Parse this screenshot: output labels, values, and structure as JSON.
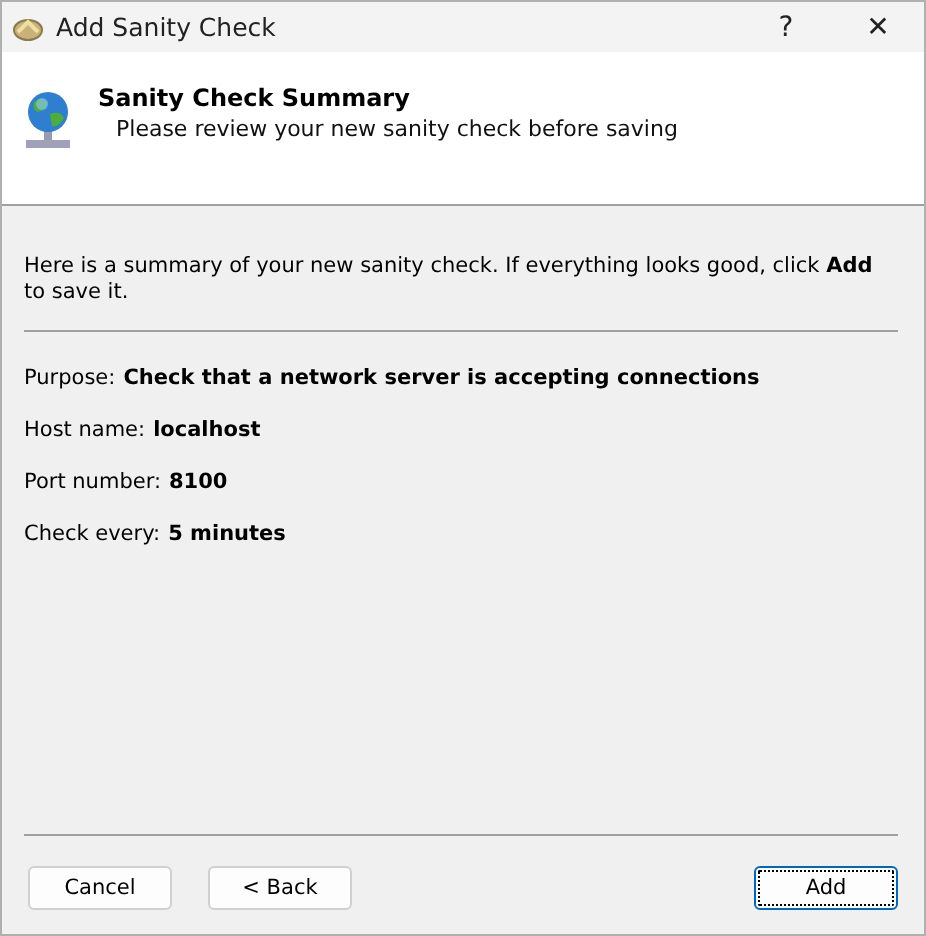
{
  "window": {
    "title": "Add Sanity Check",
    "help": "?",
    "close": "✕"
  },
  "header": {
    "title": "Sanity Check Summary",
    "subtitle": "Please review your new sanity check before saving"
  },
  "intro": "Here is a summary of your new sanity check. If everything looks good, click **Add** to save it.",
  "fields": [
    {
      "label": "Purpose:",
      "value": "Check that a network server is accepting connections"
    },
    {
      "label": "Host name:",
      "value": "localhost"
    },
    {
      "label": "Port number:",
      "value": "8100"
    },
    {
      "label": "Check every:",
      "value": "5 minutes"
    }
  ],
  "buttons": [
    {
      "label": "Cancel",
      "default": false
    },
    {
      "label": "< Back",
      "default": false
    },
    {
      "label": "Add",
      "default": true
    }
  ]
}
